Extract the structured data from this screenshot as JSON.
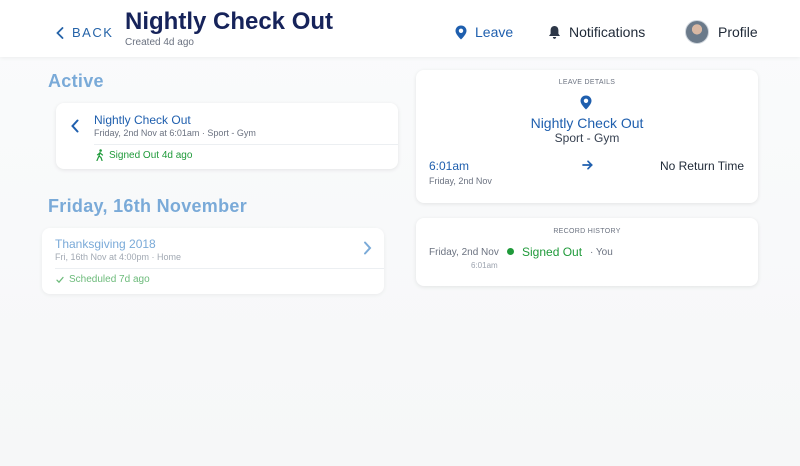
{
  "header": {
    "back_label": "BACK",
    "title": "Nightly Check Out",
    "subtitle": "Created 4d ago",
    "nav": {
      "leave": "Leave",
      "notifications": "Notifications",
      "profile": "Profile"
    }
  },
  "active": {
    "section_title": "Active",
    "card": {
      "name": "Nightly Check Out",
      "meta": "Friday, 2nd Nov at 6:01am  ·  Sport - Gym",
      "status": "Signed Out 4d ago"
    }
  },
  "upcoming": {
    "section_title": "Friday, 16th November",
    "card": {
      "name": "Thanksgiving 2018",
      "meta": "Fri, 16th Nov at 4:00pm  ·  Home",
      "status": "Scheduled 7d ago"
    }
  },
  "leave_details": {
    "label": "LEAVE DETAILS",
    "name": "Nightly Check Out",
    "place": "Sport - Gym",
    "time": "6:01am",
    "date": "Friday, 2nd Nov",
    "return": "No Return Time"
  },
  "record_history": {
    "label": "RECORD HISTORY",
    "date": "Friday, 2nd Nov",
    "time": "6:01am",
    "status": "Signed Out",
    "by": "·  You"
  },
  "colors": {
    "primary": "#1f5fae",
    "title": "#16235a",
    "section": "#7aaad8",
    "success": "#1f9a3a"
  }
}
